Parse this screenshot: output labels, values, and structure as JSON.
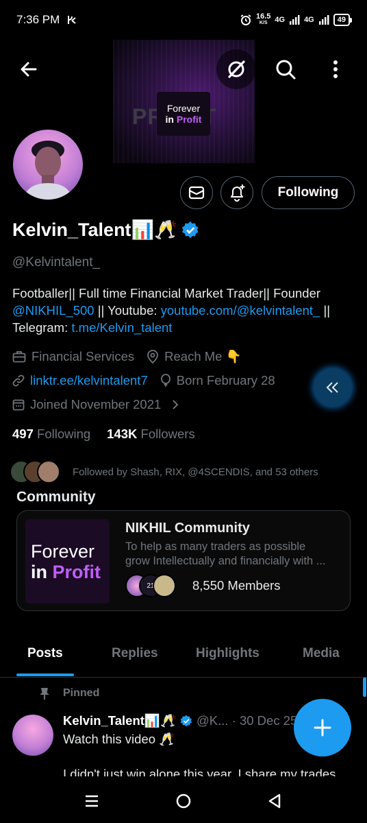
{
  "status_bar": {
    "time": "7:36 PM",
    "speed": "16.5",
    "speed_unit": "K/S",
    "network1": "4G",
    "network2": "4G",
    "battery": "49"
  },
  "banner": {
    "background_word": "PROFIT",
    "logo_line1": "Forever",
    "logo_in": "in",
    "logo_profit": "Profit"
  },
  "header_actions": {
    "following_label": "Following"
  },
  "profile": {
    "name": "Kelvin_Talent📊🥂",
    "handle": "@Kelvintalent_",
    "bio_text1": "Footballer|| Full time Financial Market Trader|| Founder ",
    "bio_mention": "@NIKHIL_500",
    "bio_text2": " || Youtube: ",
    "bio_youtube": "youtube.com/@kelvintalent_",
    "bio_text3": " || Telegram: ",
    "bio_telegram": "t.me/Kelvin_talent",
    "category": "Financial Services",
    "location": "Reach Me 👇",
    "website": "linktr.ee/kelvintalent7",
    "birthday": "Born February 28",
    "joined": "Joined November 2021",
    "following_count": "497",
    "following_label": "Following",
    "followers_count": "143K",
    "followers_label": "Followers",
    "followed_by": "Followed by Shash, RIX, @4SCENDIS, and 53 others"
  },
  "community": {
    "section_title": "Community",
    "name": "NIKHIL Community",
    "desc_line1": "To help as many traders as possible",
    "desc_line2": "grow Intellectually and financially with ...",
    "members": "8,550 Members",
    "logo_line1": "Forever",
    "logo_in": "in",
    "logo_profit": "Profit",
    "member_badge": "21"
  },
  "tabs": [
    "Posts",
    "Replies",
    "Highlights",
    "Media"
  ],
  "post": {
    "pinned_label": "Pinned",
    "author": "Kelvin_Talent📊🥂",
    "handle_date": "@K... · 30 Dec 25",
    "text": "Watch this video 🥂",
    "text2": "I didn't just win alone this year. I share my trades"
  },
  "colors": {
    "accent": "#1d9bf0",
    "background": "#000000",
    "secondary_text": "#71767b",
    "verified": "#1d9bf0"
  },
  "icons": {
    "back": "arrow-left-icon",
    "grok": "grok-icon",
    "search": "search-icon",
    "more": "more-vertical-icon",
    "message": "envelope-icon",
    "notify": "bell-plus-icon",
    "category": "briefcase-icon",
    "location": "location-pin-icon",
    "website": "link-icon",
    "birthday": "balloon-icon",
    "joined": "calendar-icon",
    "collapse": "double-chevron-left-icon",
    "compose": "plus-icon",
    "pin": "pin-icon"
  }
}
